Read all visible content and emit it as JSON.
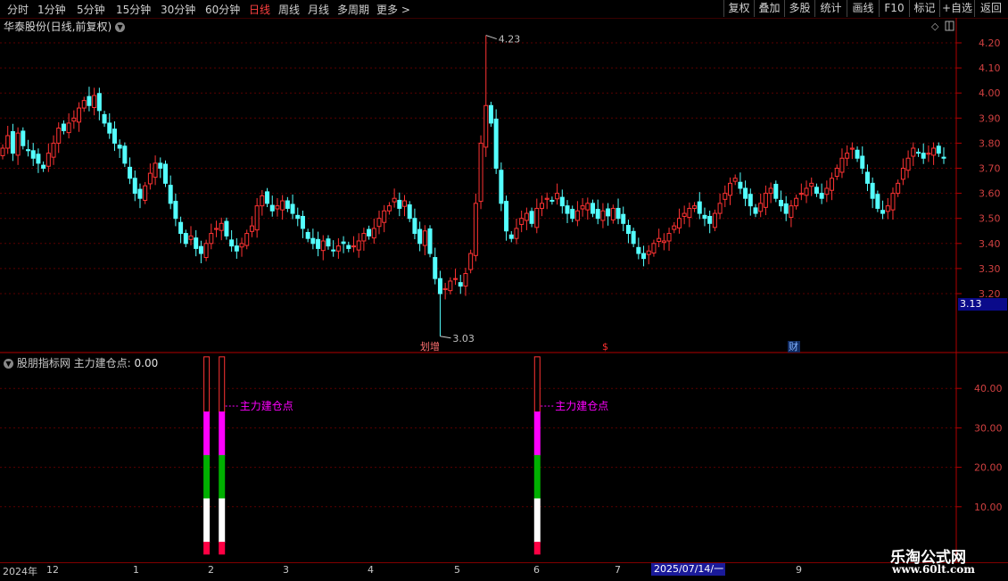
{
  "toolbar": {
    "periods": [
      "分时",
      "1分钟",
      "5分钟",
      "15分钟",
      "30分钟",
      "60分钟",
      "日线",
      "周线",
      "月线",
      "多周期",
      "更多 >"
    ],
    "active_period": "日线",
    "buttons": [
      "复权",
      "叠加",
      "多股",
      "统计",
      "画线",
      "F10",
      "标记",
      "+自选",
      "返回"
    ]
  },
  "stock": {
    "title": "华泰股份(日线,前复权)"
  },
  "price_axis": {
    "ticks": [
      "4.20",
      "4.10",
      "4.00",
      "3.90",
      "3.80",
      "3.70",
      "3.60",
      "3.50",
      "3.40",
      "3.30",
      "3.20"
    ],
    "current": "3.13"
  },
  "annotations": {
    "high": "4.23",
    "low": "3.03",
    "event1": "划增",
    "event2": "$",
    "event3": "财"
  },
  "indicator": {
    "name": "股朋指标网",
    "label": "主力建仓点:",
    "value": "0.00",
    "signal_text": "主力建仓点",
    "axis_ticks": [
      "40.00",
      "30.00",
      "20.00",
      "10.00"
    ]
  },
  "x_axis": {
    "labels": [
      "2024年",
      "12",
      "1",
      "2",
      "3",
      "4",
      "5",
      "6",
      "7",
      "9"
    ],
    "date_box": "2025/07/14/一"
  },
  "watermark": {
    "line1": "乐淘公式网",
    "line2": "www.60lt.com"
  },
  "colors": {
    "up": "#ff3333",
    "down": "#54ffff",
    "magenta": "#ff00ff",
    "green": "#00b000"
  },
  "chart_data": {
    "type": "candlestick",
    "ylim": [
      3.0,
      4.25
    ],
    "closes": [
      3.78,
      3.83,
      3.76,
      3.84,
      3.79,
      3.77,
      3.74,
      3.72,
      3.7,
      3.76,
      3.8,
      3.86,
      3.85,
      3.88,
      3.9,
      3.94,
      3.97,
      3.95,
      3.99,
      3.93,
      3.88,
      3.84,
      3.8,
      3.78,
      3.72,
      3.66,
      3.6,
      3.58,
      3.63,
      3.68,
      3.72,
      3.7,
      3.64,
      3.56,
      3.5,
      3.44,
      3.4,
      3.43,
      3.38,
      3.36,
      3.4,
      3.44,
      3.46,
      3.48,
      3.43,
      3.39,
      3.37,
      3.4,
      3.44,
      3.47,
      3.55,
      3.59,
      3.56,
      3.53,
      3.55,
      3.57,
      3.54,
      3.52,
      3.5,
      3.46,
      3.42,
      3.4,
      3.38,
      3.41,
      3.39,
      3.37,
      3.39,
      3.4,
      3.38,
      3.39,
      3.41,
      3.44,
      3.43,
      3.46,
      3.5,
      3.53,
      3.55,
      3.58,
      3.54,
      3.57,
      3.5,
      3.44,
      3.4,
      3.45,
      3.36,
      3.26,
      3.2,
      3.22,
      3.25,
      3.26,
      3.23,
      3.28,
      3.36,
      3.56,
      3.8,
      3.95,
      3.88,
      3.7,
      3.56,
      3.45,
      3.42,
      3.46,
      3.5,
      3.52,
      3.48,
      3.54,
      3.56,
      3.58,
      3.57,
      3.6,
      3.55,
      3.52,
      3.5,
      3.53,
      3.55,
      3.56,
      3.52,
      3.5,
      3.53,
      3.51,
      3.54,
      3.5,
      3.48,
      3.44,
      3.4,
      3.36,
      3.34,
      3.37,
      3.4,
      3.42,
      3.41,
      3.44,
      3.47,
      3.5,
      3.52,
      3.54,
      3.55,
      3.52,
      3.5,
      3.48,
      3.52,
      3.56,
      3.6,
      3.64,
      3.66,
      3.62,
      3.58,
      3.55,
      3.52,
      3.56,
      3.6,
      3.62,
      3.58,
      3.55,
      3.52,
      3.55,
      3.58,
      3.6,
      3.62,
      3.64,
      3.6,
      3.58,
      3.62,
      3.66,
      3.7,
      3.74,
      3.76,
      3.78,
      3.74,
      3.7,
      3.64,
      3.58,
      3.54,
      3.52,
      3.55,
      3.6,
      3.64,
      3.7,
      3.74,
      3.78,
      3.76,
      3.74,
      3.76,
      3.78,
      3.76,
      3.74
    ],
    "lows": [
      3.03
    ],
    "signal_bars": [
      40,
      43,
      105
    ],
    "indicator_ylim": [
      0,
      48
    ]
  }
}
